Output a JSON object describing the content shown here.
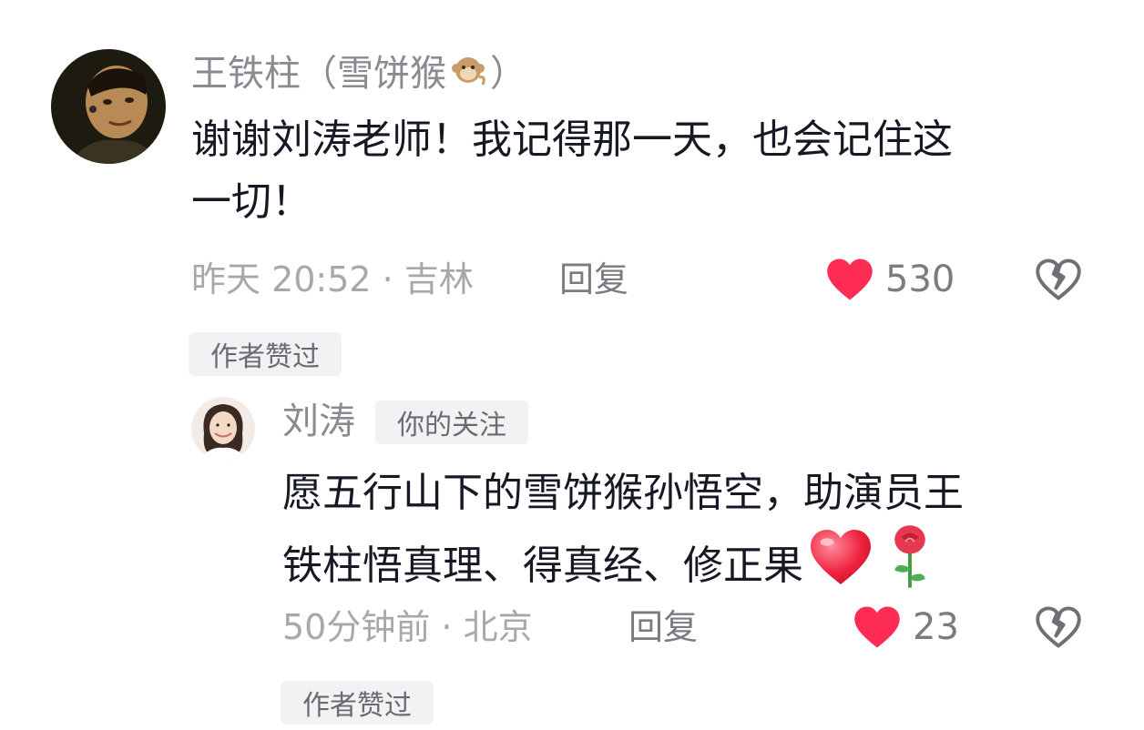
{
  "comment": {
    "username": "王铁柱（雪饼猴",
    "username_close": "）",
    "username_emoji": "monkey-icon",
    "text_line1": "谢谢刘涛老师！我记得那一天，也会记住这",
    "text_line2": "一切！",
    "meta": "昨天 20:52 · 吉林",
    "reply_label": "回复",
    "like_count": "530",
    "author_liked_badge": "作者赞过",
    "colors": {
      "heart": "#fe2c55",
      "badge_bg": "#f2f2f4"
    }
  },
  "reply": {
    "username": "刘涛",
    "follow_badge": "你的关注",
    "text_line1": "愿五行山下的雪饼猴孙悟空，助演员王",
    "text_line2": "铁柱悟真理、得真经、修正果",
    "emojis": [
      "heart-emoji-icon",
      "rose-emoji-icon"
    ],
    "meta": "50分钟前 · 北京",
    "reply_label": "回复",
    "like_count": "23",
    "author_liked_badge": "作者赞过"
  }
}
